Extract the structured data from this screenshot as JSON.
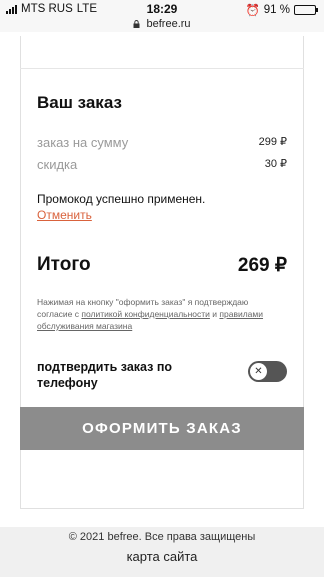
{
  "status_bar": {
    "carrier": "MTS RUS",
    "network": "LTE",
    "time": "18:29",
    "battery": "91 %",
    "battery_level": 0.91
  },
  "browser": {
    "url": "befree.ru"
  },
  "order": {
    "title": "Ваш заказ",
    "subtotal_label": "заказ на сумму",
    "subtotal_value": "299 ₽",
    "discount_label": "скидка",
    "discount_value": "30 ₽",
    "promo_message": "Промокод успешно применен.",
    "promo_cancel": "Отменить",
    "total_label": "Итого",
    "total_value": "269 ₽"
  },
  "legal": {
    "text_before": "Нажимая на кнопку \"оформить заказ\" я подтверждаю согласие с ",
    "privacy_link": "политикой конфиденциальности",
    "text_middle": " и ",
    "rules_link": "правилами обслуживания магазина"
  },
  "confirm_phone": {
    "label": "подтвердить заказ по телефону",
    "enabled": false
  },
  "checkout_button": "ОФОРМИТЬ ЗАКАЗ",
  "footer": {
    "copyright": "© 2021 befree. Все права защищены",
    "sitemap": "карта сайта"
  },
  "colors": {
    "accent_link": "#d9623c",
    "button_bg": "#8c8c8c",
    "toggle_bg": "#555555"
  }
}
